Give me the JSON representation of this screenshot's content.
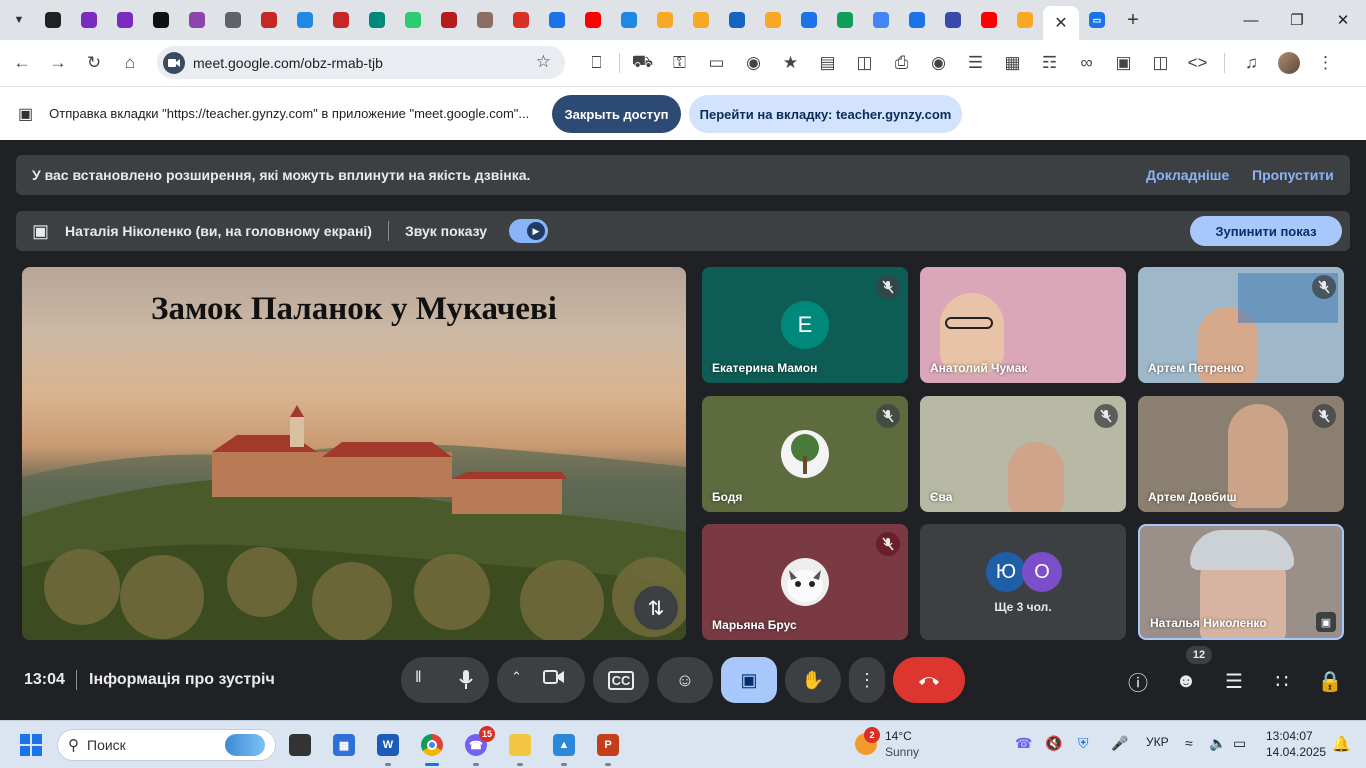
{
  "browser": {
    "url": "meet.google.com/obz-rmab-tjb",
    "tab_favicons": [
      {
        "icon": "media-icon",
        "color": "#202124"
      },
      {
        "icon": "q-icon",
        "color": "#7b2cbf"
      },
      {
        "icon": "q-icon",
        "color": "#7b2cbf"
      },
      {
        "icon": "delta-icon",
        "color": "#111111"
      },
      {
        "icon": "cube-icon",
        "color": "#8e44ad"
      },
      {
        "icon": "globe-icon",
        "color": "#5f6368"
      },
      {
        "icon": "ball-icon",
        "color": "#c62828"
      },
      {
        "icon": "puzzle-icon",
        "color": "#1e88e5"
      },
      {
        "icon": "ball-icon",
        "color": "#c62828"
      },
      {
        "icon": "chat-icon",
        "color": "#00897b"
      },
      {
        "icon": "d-icon",
        "color": "#2ecc71"
      },
      {
        "icon": "fi-icon",
        "color": "#b71c1c"
      },
      {
        "icon": "pen-icon",
        "color": "#8d6e63"
      },
      {
        "icon": "gmail-icon",
        "color": "#d93025"
      },
      {
        "icon": "g-icon",
        "color": "#1a73e8"
      },
      {
        "icon": "youtube-icon",
        "color": "#ff0000"
      },
      {
        "icon": "grid-icon",
        "color": "#1e88e5"
      },
      {
        "icon": "bell-icon",
        "color": "#f9a825"
      },
      {
        "icon": "bell-icon",
        "color": "#f9a825"
      },
      {
        "icon": "chat-icon",
        "color": "#1565c0"
      },
      {
        "icon": "bell-icon",
        "color": "#f9a825"
      },
      {
        "icon": "g-icon",
        "color": "#1a73e8"
      },
      {
        "icon": "classroom-icon",
        "color": "#0f9d58"
      },
      {
        "icon": "google-icon",
        "color": "#4285f4"
      },
      {
        "icon": "g-icon",
        "color": "#1a73e8"
      },
      {
        "icon": "app-icon",
        "color": "#3949ab"
      },
      {
        "icon": "youtube-icon",
        "color": "#ff0000"
      },
      {
        "icon": "bell-icon",
        "color": "#f9a825"
      }
    ]
  },
  "share_bar": {
    "message": "Отправка вкладки \"https://teacher.gynzy.com\" в приложение \"meet.google.com\"...",
    "stop_label": "Закрыть доступ",
    "goto_label": "Перейти на вкладку: teacher.gynzy.com"
  },
  "notice": {
    "text": "У вас встановлено розширення, які можуть вплинути на якість дзвінка.",
    "more_label": "Докладніше",
    "skip_label": "Пропустити"
  },
  "presenting": {
    "text": "Наталія Ніколенко (ви, на головному екрані)",
    "audio_label": "Звук показу",
    "stop_label": "Зупинити показ"
  },
  "slide": {
    "title": "Замок Паланок у Мукачеві"
  },
  "participants": [
    {
      "name": "Екатерина Мамон",
      "muted": true,
      "avatar": "Е",
      "avatar_color": "#00897b",
      "bg": "#0d5d56"
    },
    {
      "name": "Анатолий Чумак",
      "muted": false,
      "bg": "#d9a7b8"
    },
    {
      "name": "Артем Петренко",
      "muted": true,
      "bg": "#9fb8c9"
    },
    {
      "name": "Бодя",
      "muted": true,
      "bg": "#5d6b3f"
    },
    {
      "name": "Єва",
      "muted": true,
      "bg": "#b7b9a4"
    },
    {
      "name": "Артем Довбиш",
      "muted": true,
      "bg": "#8a7f70"
    },
    {
      "name": "Марьяна Брус",
      "muted": true,
      "bg": "#7a3a44"
    },
    {
      "name": "Наталья Николенко",
      "muted": false,
      "bg": "#9b8f8a"
    }
  ],
  "more_participants": {
    "label": "Ще 3 чол.",
    "avatars": [
      "Ю",
      "О"
    ]
  },
  "controls": {
    "time": "13:04",
    "meeting_info": "Інформація про зустріч",
    "people_count": "12"
  },
  "taskbar": {
    "search_placeholder": "Поиск",
    "weather_temp": "14°C",
    "weather_desc": "Sunny",
    "weather_badge": "2",
    "viber_badge": "15",
    "lang": "УКР",
    "clock_time": "13:04:07",
    "clock_date": "14.04.2025"
  }
}
